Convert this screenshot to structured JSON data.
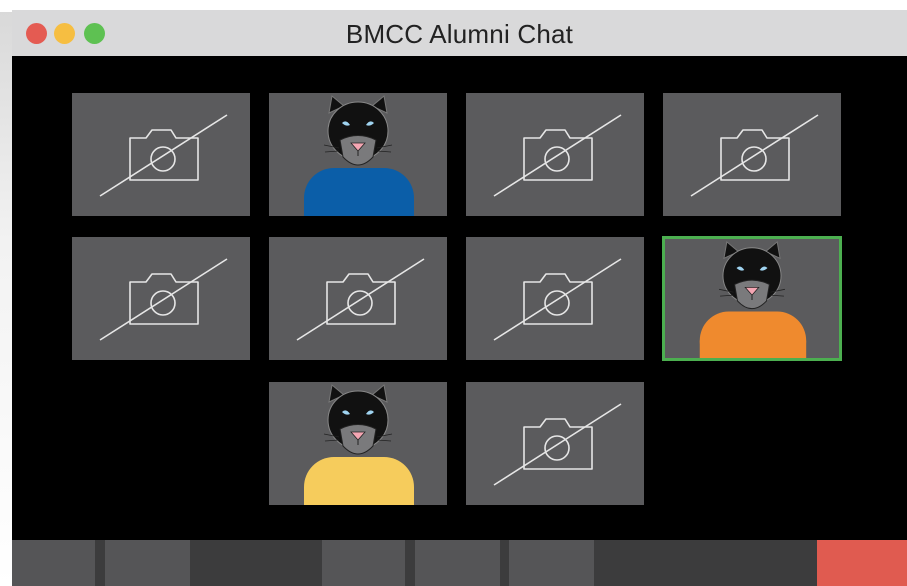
{
  "window": {
    "title": "BMCC Alumni Chat",
    "controls": [
      "close",
      "minimize",
      "maximize"
    ]
  },
  "participants": [
    {
      "id": 1,
      "video": false,
      "icon": "camera-off-icon"
    },
    {
      "id": 2,
      "video": true,
      "avatar": "panther-avatar",
      "shirt_color": "#0b5ea8"
    },
    {
      "id": 3,
      "video": false,
      "icon": "camera-off-icon"
    },
    {
      "id": 4,
      "video": false,
      "icon": "camera-off-icon"
    },
    {
      "id": 5,
      "video": false,
      "icon": "camera-off-icon"
    },
    {
      "id": 6,
      "video": false,
      "icon": "camera-off-icon"
    },
    {
      "id": 7,
      "video": false,
      "icon": "camera-off-icon"
    },
    {
      "id": 8,
      "video": true,
      "avatar": "panther-avatar",
      "shirt_color": "#ef8a2e",
      "active_speaker": true
    },
    {
      "id": 9,
      "video": true,
      "avatar": "panther-avatar",
      "shirt_color": "#f6cc5c"
    },
    {
      "id": 10,
      "video": false,
      "icon": "camera-off-icon"
    }
  ],
  "colors": {
    "active_speaker_border": "#4caf50",
    "end_call": "#e05b50",
    "tile_background": "#5b5b5d"
  },
  "toolbar": {
    "buttons": [
      "button-1",
      "button-2",
      "button-3",
      "button-4",
      "button-5",
      "end-call"
    ]
  }
}
